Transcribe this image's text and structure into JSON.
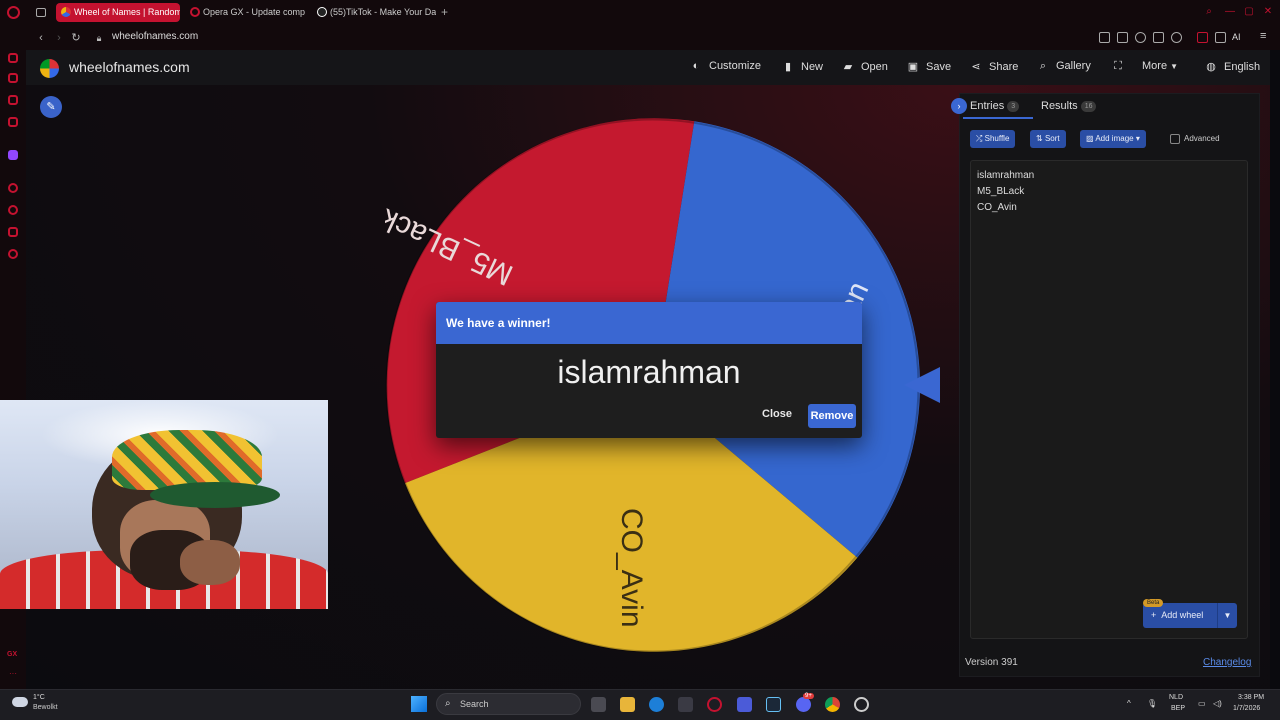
{
  "browser": {
    "tabs": [
      {
        "label": "Wheel of Names | Random",
        "active": true,
        "icon": "wheel-favicon-icon"
      },
      {
        "label": "Opera GX - Update comp",
        "active": false,
        "icon": "opera-gx-icon"
      },
      {
        "label": "(55)TikTok - Make Your Da",
        "active": false,
        "icon": "tiktok-icon"
      }
    ],
    "url": "wheelofnames.com",
    "accent_color": "#c41230"
  },
  "site": {
    "title": "wheelofnames.com",
    "nav": {
      "customize": "Customize",
      "new": "New",
      "open": "Open",
      "save": "Save",
      "share": "Share",
      "gallery": "Gallery",
      "more": "More",
      "language": "English"
    }
  },
  "wheel": {
    "segments": [
      {
        "label": "M5_BLack",
        "color": "#c4192f"
      },
      {
        "label": "islamrahman",
        "color": "#3567cf"
      },
      {
        "label": "CO_Avin",
        "color": "#e1b52a"
      }
    ],
    "visible_text": {
      "black": "M5_BLack",
      "avin": "CO_Avin",
      "partial": "an"
    },
    "pointer_color": "#3a67d2"
  },
  "dialog": {
    "title": "We have a winner!",
    "winner": "islamrahman",
    "close_label": "Close",
    "remove_label": "Remove",
    "header_color": "#3a67d2"
  },
  "panel": {
    "tabs": [
      {
        "label": "Entries",
        "count": "3"
      },
      {
        "label": "Results",
        "count": "16"
      }
    ],
    "toolbar": {
      "shuffle": "Shuffle",
      "sort": "Sort",
      "add_image": "Add image",
      "advanced": "Advanced"
    },
    "entries": [
      "islamrahman",
      "M5_BLack",
      "CO_Avin"
    ],
    "add_wheel": {
      "label": "Add wheel",
      "badge": "Beta"
    },
    "version": "Version 391",
    "changelog": "Changelog"
  },
  "taskbar": {
    "weather": {
      "temp": "1°C",
      "desc": "Bewolkt"
    },
    "search_label": "Search",
    "lang": {
      "line1": "NLD",
      "line2": "BEP"
    },
    "clock": {
      "time": "3:38 PM",
      "date": "1/7/2026"
    },
    "discord_badge": "9+"
  }
}
